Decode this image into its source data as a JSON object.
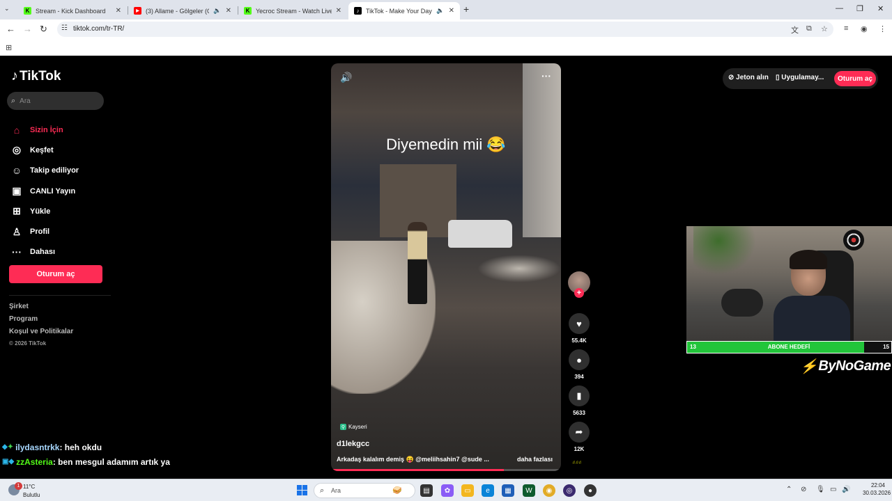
{
  "browser": {
    "tabs": [
      {
        "title": "Stream - Kick Dashboard",
        "favicon": "K",
        "fav_color": "#53fc18"
      },
      {
        "title": "(3) Allame - Gölgeler (Offici",
        "favicon": "▶",
        "fav_color": "#ff0000"
      },
      {
        "title": "Yecroc Stream - Watch Live on",
        "favicon": "K",
        "fav_color": "#53fc18"
      },
      {
        "title": "TikTok - Make Your Day",
        "favicon": "♪",
        "fav_color": "#000000"
      }
    ],
    "url": "tiktok.com/tr-TR/"
  },
  "sidebar": {
    "logo": "TikTok",
    "search_placeholder": "Ara",
    "items": [
      {
        "label": "Sizin İçin",
        "icon": "home-icon",
        "glyph": "⌂"
      },
      {
        "label": "Keşfet",
        "icon": "compass-icon",
        "glyph": "◎"
      },
      {
        "label": "Takip ediliyor",
        "icon": "following-icon",
        "glyph": "☺"
      },
      {
        "label": "CANLI Yayın",
        "icon": "live-icon",
        "glyph": "▣"
      },
      {
        "label": "Yükle",
        "icon": "upload-icon",
        "glyph": "⊞"
      },
      {
        "label": "Profil",
        "icon": "profile-icon",
        "glyph": "♙"
      },
      {
        "label": "Dahası",
        "icon": "more-icon",
        "glyph": "···"
      }
    ],
    "login_button": "Oturum aç",
    "footer": [
      "Şirket",
      "Program",
      "Koşul ve Politikalar"
    ],
    "copyright": "© 2026 TikTok"
  },
  "video": {
    "caption": "Diyemedin mii 😂",
    "location": "Kayseri",
    "username": "d1lekgcc",
    "description": "Arkadaş kalalım demiş 😝 @meliihsahin7 @sude ...",
    "more_label": "daha fazlası",
    "progress": 0.75
  },
  "actions": {
    "likes": "55.4K",
    "comments": "394",
    "saves": "5633",
    "shares": "12K"
  },
  "topright": {
    "coins": "Jeton alın",
    "app": "Uygulamay...",
    "login": "Oturum aç"
  },
  "overlay": {
    "sub_goal_current": "13",
    "sub_goal_label": "ABONE HEDEFİ",
    "sub_goal_target": "15",
    "sub_goal_progress": 0.8667,
    "brand": "ByNoGame",
    "chat": [
      {
        "user": "ilydasntrkk",
        "message": ": heh okdu"
      },
      {
        "user": "zzAsteria",
        "message": ": ben mesgul adamım artık ya"
      }
    ]
  },
  "taskbar": {
    "temp": "11°C",
    "condition": "Bulutlu",
    "notif_count": "1",
    "search_placeholder": "Ara",
    "time": "22:04",
    "date": "30.03.2026"
  }
}
